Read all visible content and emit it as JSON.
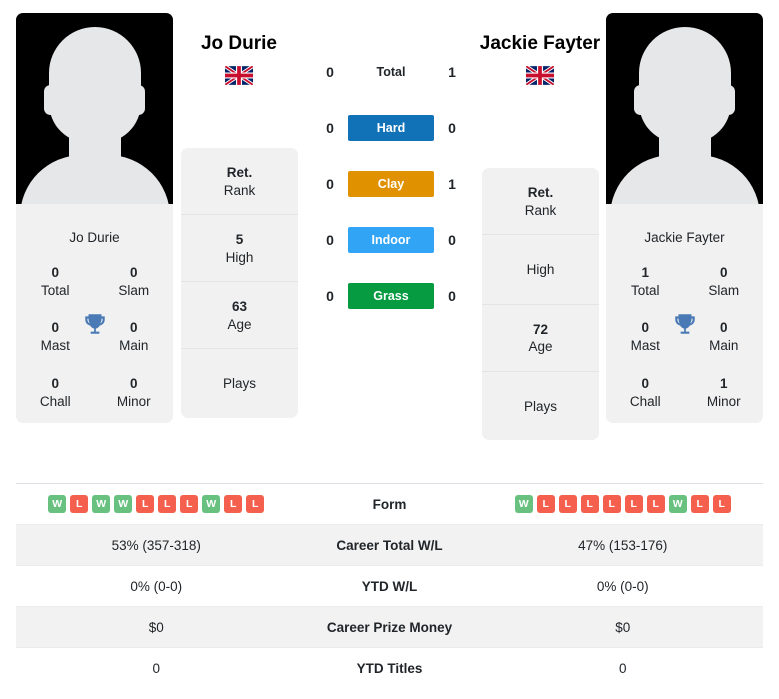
{
  "players": {
    "left": {
      "name": "Jo Durie",
      "flag": "gb-flag-icon",
      "photo_name": "Jo Durie",
      "titles": [
        {
          "value": "0",
          "label": "Total"
        },
        {
          "value": "0",
          "label": "Slam"
        },
        {
          "value": "0",
          "label": "Mast"
        },
        {
          "value": "0",
          "label": "Main"
        },
        {
          "value": "0",
          "label": "Chall"
        },
        {
          "value": "0",
          "label": "Minor"
        }
      ],
      "rank_rows": [
        {
          "value": "Ret.",
          "label": "Rank"
        },
        {
          "value": "5",
          "label": "High"
        },
        {
          "value": "63",
          "label": "Age"
        },
        {
          "value": "",
          "label": "Plays"
        }
      ],
      "form": [
        "W",
        "L",
        "W",
        "W",
        "L",
        "L",
        "L",
        "W",
        "L",
        "L"
      ],
      "career_total_wl": "53% (357-318)",
      "ytd_wl": "0% (0-0)",
      "career_prize_money": "$0",
      "ytd_titles": "0"
    },
    "right": {
      "name": "Jackie Fayter",
      "flag": "gb-flag-icon",
      "photo_name": "Jackie Fayter",
      "titles": [
        {
          "value": "1",
          "label": "Total"
        },
        {
          "value": "0",
          "label": "Slam"
        },
        {
          "value": "0",
          "label": "Mast"
        },
        {
          "value": "0",
          "label": "Main"
        },
        {
          "value": "0",
          "label": "Chall"
        },
        {
          "value": "1",
          "label": "Minor"
        }
      ],
      "rank_rows": [
        {
          "value": "Ret.",
          "label": "Rank"
        },
        {
          "value": "",
          "label": "High"
        },
        {
          "value": "72",
          "label": "Age"
        },
        {
          "value": "",
          "label": "Plays"
        }
      ],
      "form": [
        "W",
        "L",
        "L",
        "L",
        "L",
        "L",
        "L",
        "W",
        "L",
        "L"
      ],
      "career_total_wl": "47% (153-176)",
      "ytd_wl": "0% (0-0)",
      "career_prize_money": "$0",
      "ytd_titles": "0"
    }
  },
  "head_to_head": [
    {
      "label": "Total",
      "left": "0",
      "right": "1",
      "badge": false,
      "color": ""
    },
    {
      "label": "Hard",
      "left": "0",
      "right": "0",
      "badge": true,
      "color": "#1172b8"
    },
    {
      "label": "Clay",
      "left": "0",
      "right": "1",
      "badge": true,
      "color": "#e09100"
    },
    {
      "label": "Indoor",
      "left": "0",
      "right": "0",
      "badge": true,
      "color": "#32a4f5"
    },
    {
      "label": "Grass",
      "left": "0",
      "right": "0",
      "badge": true,
      "color": "#069a41"
    }
  ],
  "table": {
    "rows": [
      {
        "label": "Form",
        "left": "",
        "right": "",
        "type": "form"
      },
      {
        "label": "Career Total W/L",
        "left": "53% (357-318)",
        "right": "47% (153-176)",
        "type": "text"
      },
      {
        "label": "YTD W/L",
        "left": "0% (0-0)",
        "right": "0% (0-0)",
        "type": "text"
      },
      {
        "label": "Career Prize Money",
        "left": "$0",
        "right": "$0",
        "type": "text"
      },
      {
        "label": "YTD Titles",
        "left": "0",
        "right": "0",
        "type": "text"
      }
    ]
  },
  "colors": {
    "win": "#68c17f",
    "loss": "#f4604d",
    "card_bg": "#f1f1f1",
    "row_alt_bg": "#f2f2f2",
    "trophy": "#4a7ab5"
  }
}
